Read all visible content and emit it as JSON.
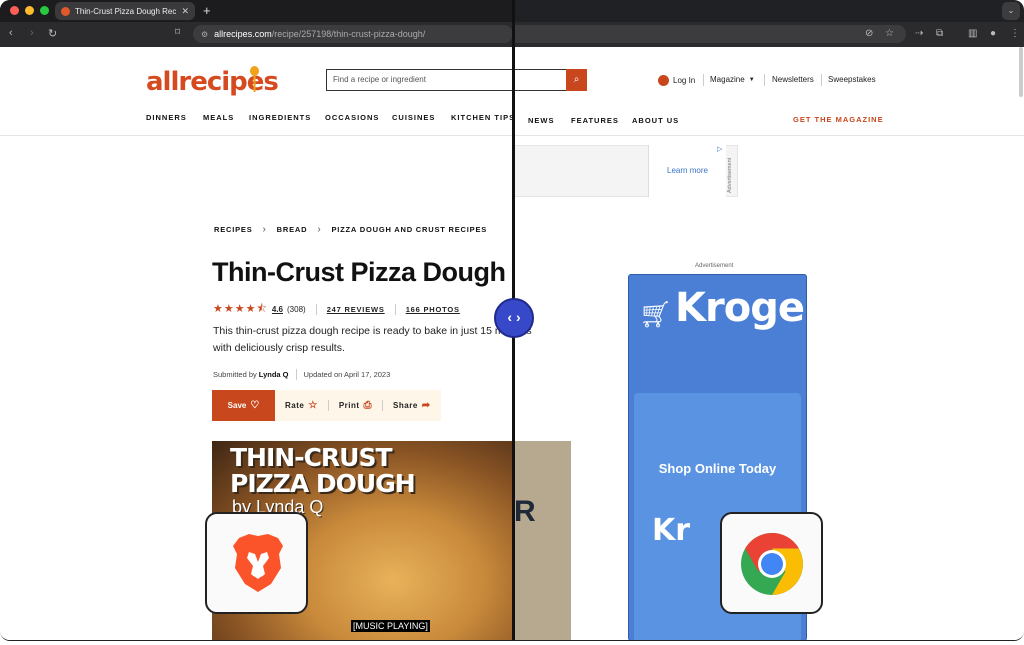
{
  "browser": {
    "tab_title": "Thin-Crust Pizza Dough Recipe",
    "tab_close": "✕",
    "new_tab": "+",
    "url_domain": "allrecipes.com",
    "url_path": "/recipe/257198/thin-crust-pizza-dough/"
  },
  "site": {
    "logo": "allrecipes",
    "search_placeholder": "Find a recipe or ingredient",
    "login": "Log In",
    "magazine": "Magazine",
    "newsletters": "Newsletters",
    "sweepstakes": "Sweepstakes",
    "nav": [
      "DINNERS",
      "MEALS",
      "INGREDIENTS",
      "OCCASIONS",
      "CUISINES",
      "KITCHEN TIPS",
      "NEWS",
      "FEATURES",
      "ABOUT US"
    ],
    "get_magazine": "GET THE MAGAZINE"
  },
  "ad_top": {
    "learn_more": "Learn more",
    "label": "Advertisement"
  },
  "breadcrumbs": [
    "RECIPES",
    "BREAD",
    "PIZZA DOUGH AND CRUST RECIPES"
  ],
  "recipe": {
    "title": "Thin-Crust Pizza Dough",
    "stars": "★★★★⯪",
    "rating": "4.6",
    "rating_count": "(308)",
    "reviews": "247 REVIEWS",
    "photos": "166 PHOTOS",
    "description": "This thin-crust pizza dough recipe is ready to bake in just 15 minutes with deliciously crisp results.",
    "submitted_by_prefix": "Submitted by",
    "author": "Lynda Q",
    "updated": "Updated on April 17, 2023",
    "actions": {
      "save": "Save",
      "rate": "Rate",
      "print": "Print",
      "share": "Share"
    }
  },
  "hero": {
    "line1": "THIN-CRUST",
    "line2": "PIZZA DOUGH",
    "by": "by Lynda Q",
    "caption": "[MUSIC PLAYING]",
    "side_letter": "R"
  },
  "kroger_ad": {
    "label": "Advertisement",
    "brand": "Kroger",
    "cta": "Shop Online Today",
    "brand_partial": "Kr"
  },
  "colors": {
    "accent": "#c9471c",
    "kroger_blue": "#4a7fd5",
    "toggle": "#3748c9"
  }
}
